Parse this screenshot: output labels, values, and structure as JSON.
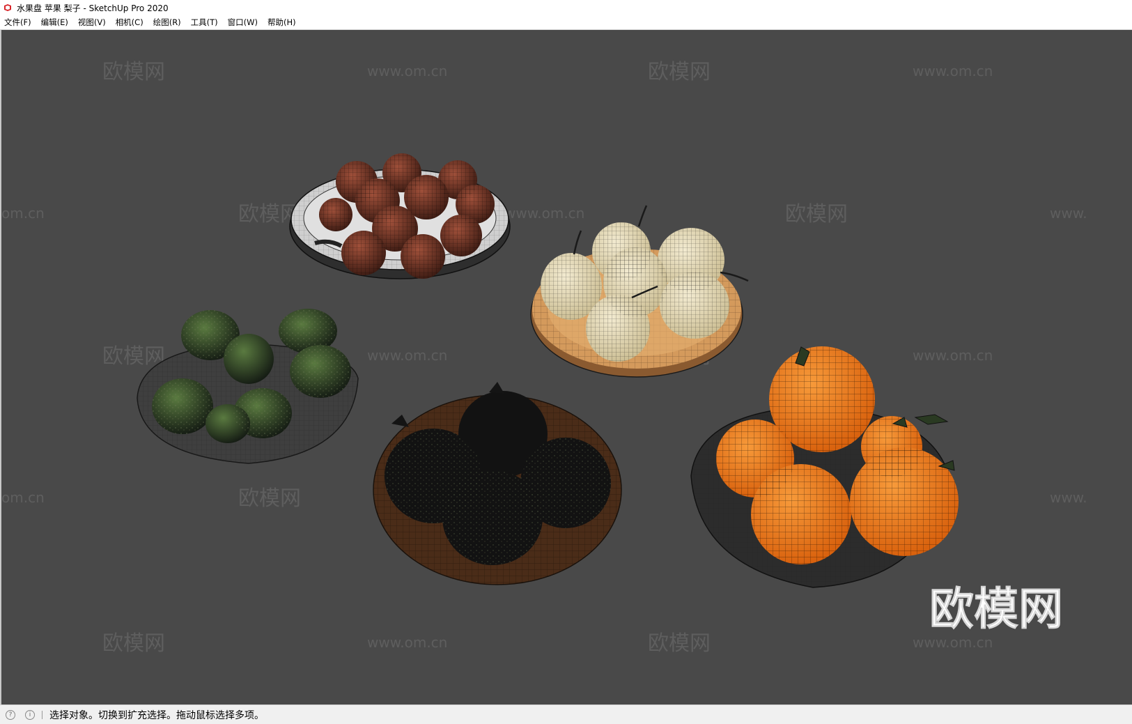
{
  "window": {
    "title": "水果盘 苹果 梨子 - SketchUp Pro 2020"
  },
  "menu": [
    {
      "label": "文件(F)"
    },
    {
      "label": "编辑(E)"
    },
    {
      "label": "视图(V)"
    },
    {
      "label": "相机(C)"
    },
    {
      "label": "绘图(R)"
    },
    {
      "label": "工具(T)"
    },
    {
      "label": "窗口(W)"
    },
    {
      "label": "帮助(H)"
    }
  ],
  "watermarks": {
    "brand": "欧模网",
    "url": "www.om.cn",
    "url_partial_left": "om.cn",
    "url_partial_right": "www."
  },
  "logo_text": "欧模网",
  "status": {
    "message": "选择对象。切换到扩充选择。拖动鼠标选择多项。"
  },
  "colors": {
    "viewport_bg": "#494949",
    "orange": "#e8781e",
    "pear": "#e6d9b0",
    "apple": "#8a3a22",
    "plate": "#cccccc",
    "wood": "#c9884a"
  }
}
